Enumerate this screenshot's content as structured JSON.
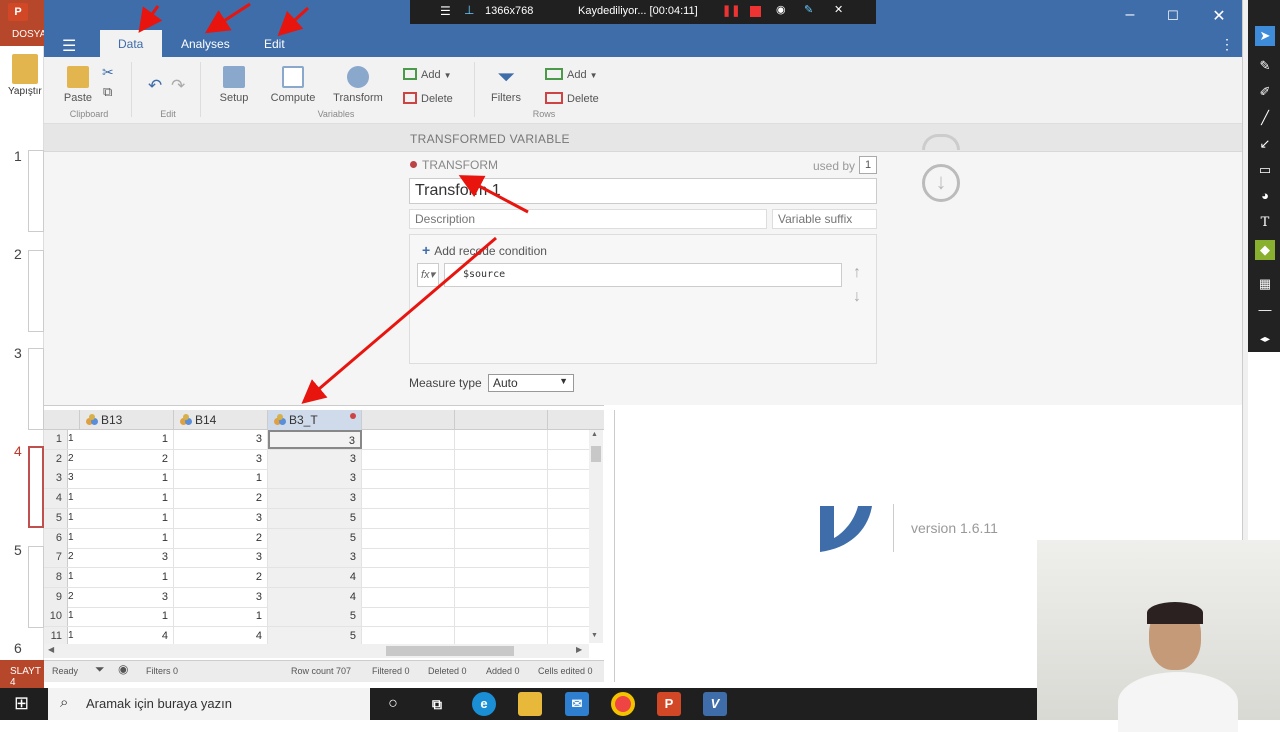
{
  "recording": {
    "resolution": "1366x768",
    "status": "Kaydediliyor... [00:04:11]"
  },
  "ppt": {
    "logo": "P",
    "file_tab": "DOSYA",
    "paste_label": "Yapıştır",
    "slide_numbers": [
      "1",
      "2",
      "3",
      "4",
      "5",
      "6"
    ],
    "status": "SLAYT 4"
  },
  "menu": {
    "tabs": [
      "Data",
      "Analyses",
      "Edit"
    ],
    "active": "Data"
  },
  "ribbon": {
    "paste": "Paste",
    "clipboard_group": "Clipboard",
    "edit_group": "Edit",
    "setup": "Setup",
    "compute": "Compute",
    "transform": "Transform",
    "variables_group": "Variables",
    "add": "Add",
    "delete": "Delete",
    "filters": "Filters",
    "rows_add": "Add",
    "rows_delete": "Delete",
    "rows_group": "Rows"
  },
  "transform_panel": {
    "header": "TRANSFORMED VARIABLE",
    "section_label": "TRANSFORM",
    "used_by_label": "used by",
    "used_by_count": "1",
    "name": "Transform 1",
    "description_placeholder": "Description",
    "suffix_placeholder": "Variable suffix",
    "add_recode": "Add recode condition",
    "fx_label": "fx",
    "formula": "$source",
    "measure_type_label": "Measure type",
    "measure_type_value": "Auto"
  },
  "sheet": {
    "columns": [
      "B13",
      "B14",
      "B3_T"
    ],
    "rows": [
      {
        "n": "1",
        "strip": "1",
        "b13": "1",
        "b14": "3",
        "b3t": "3"
      },
      {
        "n": "2",
        "strip": "2",
        "b13": "2",
        "b14": "3",
        "b3t": "3"
      },
      {
        "n": "3",
        "strip": "3",
        "b13": "1",
        "b14": "1",
        "b3t": "3"
      },
      {
        "n": "4",
        "strip": "1",
        "b13": "1",
        "b14": "2",
        "b3t": "3"
      },
      {
        "n": "5",
        "strip": "1",
        "b13": "1",
        "b14": "3",
        "b3t": "5"
      },
      {
        "n": "6",
        "strip": "1",
        "b13": "1",
        "b14": "2",
        "b3t": "5"
      },
      {
        "n": "7",
        "strip": "2",
        "b13": "3",
        "b14": "3",
        "b3t": "3"
      },
      {
        "n": "8",
        "strip": "1",
        "b13": "1",
        "b14": "2",
        "b3t": "4"
      },
      {
        "n": "9",
        "strip": "2",
        "b13": "3",
        "b14": "3",
        "b3t": "4"
      },
      {
        "n": "10",
        "strip": "1",
        "b13": "1",
        "b14": "1",
        "b3t": "5"
      },
      {
        "n": "11",
        "strip": "1",
        "b13": "4",
        "b14": "4",
        "b3t": "5"
      }
    ]
  },
  "status": {
    "ready": "Ready",
    "filters": "Filters 0",
    "row_count": "Row count 707",
    "filtered": "Filtered 0",
    "deleted": "Deleted 0",
    "added": "Added 0",
    "cells_edited": "Cells edited 0"
  },
  "results": {
    "version": "version 1.6.11"
  },
  "taskbar": {
    "search_placeholder": "Aramak için buraya yazın"
  },
  "colors": {
    "accent": "#3e6da9",
    "ppt": "#b7472a",
    "annotation": "#e8140e"
  }
}
